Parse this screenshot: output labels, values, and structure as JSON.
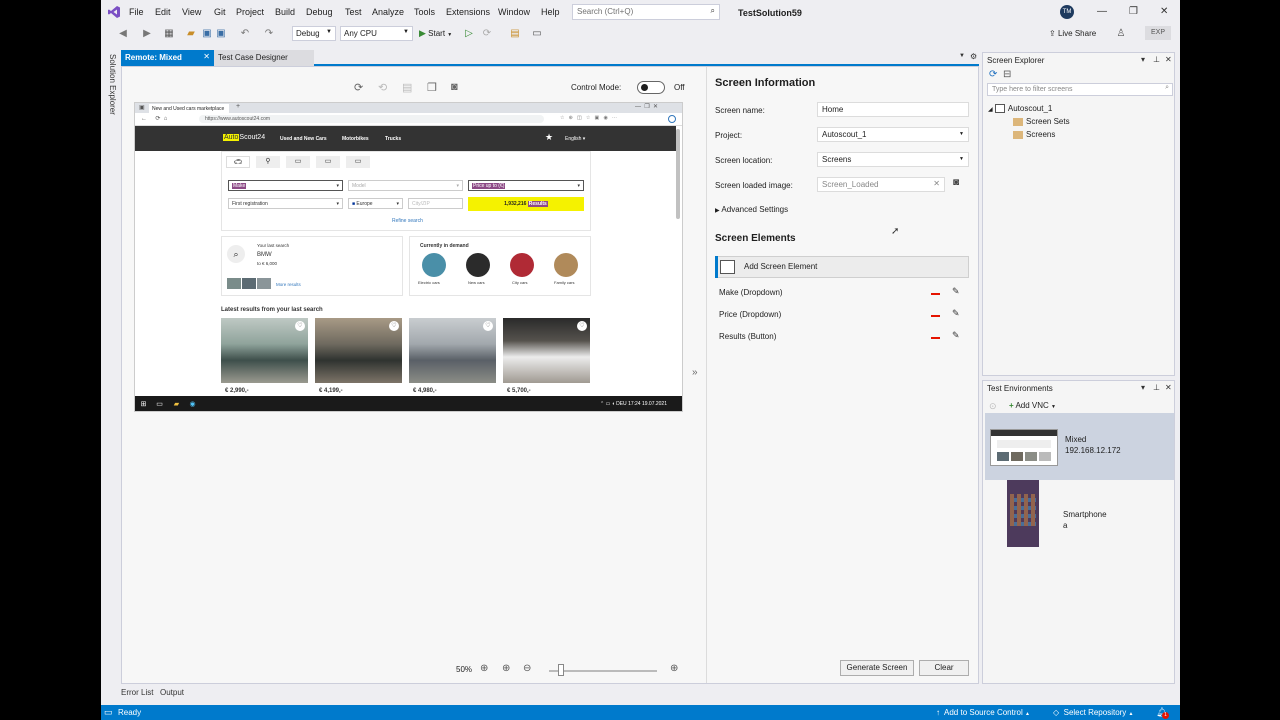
{
  "menu": [
    "File",
    "Edit",
    "View",
    "Git",
    "Project",
    "Build",
    "Debug",
    "Test",
    "Analyze",
    "Tools",
    "Extensions",
    "Window",
    "Help"
  ],
  "search_placeholder": "Search (Ctrl+Q)",
  "solution_name": "TestSolution59",
  "user_initials": "TM",
  "toolbar": {
    "config": "Debug",
    "platform": "Any CPU",
    "start": "Start",
    "live_share": "Live Share",
    "exp": "EXP"
  },
  "solution_explorer_tab": "Solution Explorer",
  "doc_tabs": {
    "active": "Remote: Mixed",
    "other": "Test Case Designer"
  },
  "designer": {
    "control_mode_label": "Control Mode:",
    "control_mode_state": "Off",
    "zoom": "50%"
  },
  "remote": {
    "browser_tab": "New and Used cars marketplace",
    "url": "https://www.autoscout24.com",
    "logo_a": "Auto",
    "logo_b": "Scout24",
    "nav": [
      "Used and New Cars",
      "Motorbikes",
      "Trucks"
    ],
    "language": "English",
    "make_value": "Make",
    "model_placeholder": "Model",
    "price_value": "Price up to (€)",
    "first_reg": "First registration",
    "country": "Europe",
    "city_placeholder": "City/ZIP",
    "results_a": "1,932,216",
    "results_b": "Results",
    "refine": "Refine search",
    "last_search_title": "Your last search",
    "last_search_make": "BMW",
    "last_search_price": "to € 6,000",
    "more_results": "More results",
    "demand_title": "Currently in demand",
    "demand": [
      "Electric cars",
      "New cars",
      "City cars",
      "Family cars"
    ],
    "latest_title": "Latest results from your last search",
    "prices": [
      "€ 2,990,-",
      "€ 4,199,-",
      "€ 4,980,-",
      "€ 5,700,-"
    ],
    "tray_time": "17:24",
    "tray_date": "19.07.2021",
    "tray_lang": "DEU"
  },
  "screen_info": {
    "title": "Screen Information",
    "fields": [
      {
        "label": "Screen name:",
        "value": "Home"
      },
      {
        "label": "Project:",
        "value": "Autoscout_1"
      },
      {
        "label": "Screen location:",
        "value": "Screens"
      },
      {
        "label": "Screen loaded image:",
        "value": "Screen_Loaded"
      }
    ],
    "advanced": "Advanced Settings",
    "elements_title": "Screen Elements",
    "add_element": "Add Screen Element",
    "elements": [
      "Make (Dropdown)",
      "Price (Dropdown)",
      "Results (Button)"
    ],
    "generate": "Generate Screen",
    "clear": "Clear"
  },
  "screen_explorer": {
    "title": "Screen Explorer",
    "filter_placeholder": "Type here to filter screens",
    "tree": {
      "root": "Autoscout_1",
      "children": [
        "Screen Sets",
        "Screens"
      ]
    }
  },
  "test_env": {
    "title": "Test Environments",
    "add_vnc": "Add VNC",
    "envs": [
      {
        "name": "Mixed",
        "detail": "192.168.12.172"
      },
      {
        "name": "Smartphone",
        "detail": "a"
      }
    ]
  },
  "bottom_tabs": [
    "Error List",
    "Output"
  ],
  "status": {
    "ready": "Ready",
    "source_control": "Add to Source Control",
    "repo": "Select Repository",
    "notifications": "1"
  },
  "colors": {
    "accent": "#007acc",
    "site_header": "#333333",
    "highlight_yellow": "#f5f200",
    "remove_red": "#e51400"
  }
}
